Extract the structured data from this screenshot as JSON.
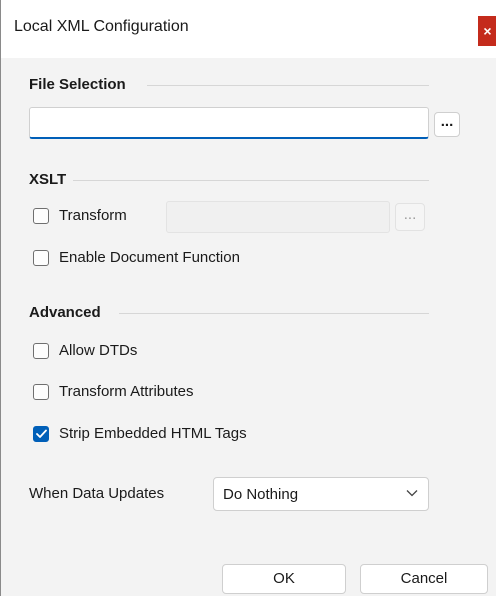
{
  "window": {
    "title": "Local XML Configuration",
    "close_glyph": "×"
  },
  "file_section": {
    "title": "File Selection",
    "input_value": "",
    "browse_label": "..."
  },
  "xslt_section": {
    "title": "XSLT",
    "transform_label": "Transform",
    "transform_checked": false,
    "transform_browse_label": "...",
    "enable_document_function_label": "Enable Document Function",
    "enable_document_function_checked": false
  },
  "advanced_section": {
    "title": "Advanced",
    "allow_dtds_label": "Allow DTDs",
    "allow_dtds_checked": false,
    "transform_attributes_label": "Transform Attributes",
    "transform_attributes_checked": false,
    "strip_html_label": "Strip Embedded HTML Tags",
    "strip_html_checked": true
  },
  "when_data_updates": {
    "label": "When Data Updates",
    "selected": "Do Nothing"
  },
  "buttons": {
    "ok": "OK",
    "cancel": "Cancel"
  },
  "colors": {
    "accent": "#005fb8",
    "close": "#c42b1c"
  }
}
